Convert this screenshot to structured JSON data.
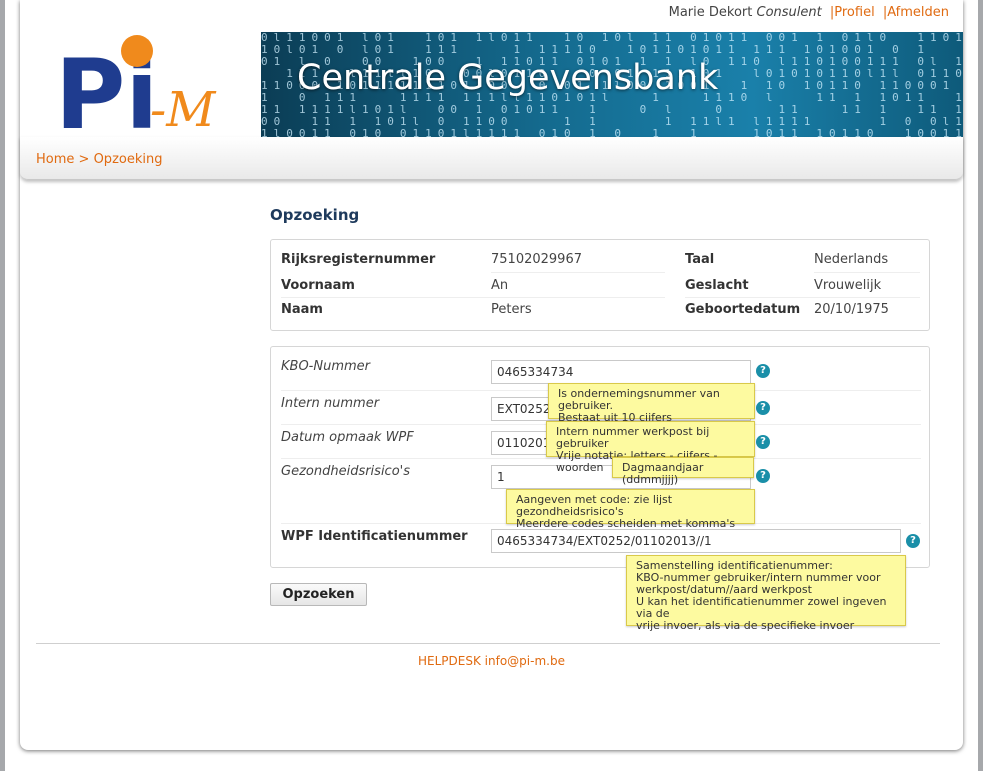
{
  "user": {
    "name": "Marie Dekort",
    "role": "Consulent",
    "profile_link": "Profiel",
    "logout_link": "Afmelden",
    "separator": "|"
  },
  "logo": {
    "text_main": "Pi",
    "text_accent": "-M"
  },
  "banner": {
    "title": "Centrale Gegevensbank"
  },
  "breadcrumb": {
    "home": "Home",
    "separator": ">",
    "current": "Opzoeking"
  },
  "page_title": "Opzoeking",
  "person": {
    "rijksregister_label": "Rijksregisternummer",
    "rijksregister_value": "75102029967",
    "taal_label": "Taal",
    "taal_value": "Nederlands",
    "voornaam_label": "Voornaam",
    "voornaam_value": "An",
    "geslacht_label": "Geslacht",
    "geslacht_value": "Vrouwelijk",
    "naam_label": "Naam",
    "naam_value": "Peters",
    "geboortedatum_label": "Geboortedatum",
    "geboortedatum_value": "20/10/1975"
  },
  "form": {
    "kbo": {
      "label": "KBO-Nummer",
      "value": "0465334734",
      "tooltip": "Is ondernemingsnummer van gebruiker.\nBestaat uit 10 cijfers"
    },
    "intern": {
      "label": "Intern nummer",
      "value": "EXT0252",
      "tooltip": "Intern nummer werkpost bij gebruiker\nVrije notatie: letters - cijfers - woorden"
    },
    "datum": {
      "label": "Datum opmaak WPF",
      "value": "01102013",
      "tooltip": "Dagmaandjaar (ddmmjjjj)"
    },
    "risico": {
      "label": "Gezondheidsrisico's",
      "value": "1",
      "tooltip": "Aangeven met code: zie lijst gezondheidsrisico's\nMeerdere codes scheiden met komma's"
    },
    "wpf": {
      "label": "WPF Identificatienummer",
      "value": "0465334734/EXT0252/01102013//1",
      "tooltip": "Samenstelling identificatienummer:\nKBO-nummer gebruiker/intern nummer voor\nwerkpost/datum//aard werkpost\nU kan het identificatienummer zowel ingeven via de\nvrije invoer, als via de specifieke invoer"
    },
    "help_glyph": "?"
  },
  "search_button": "Opzoeken",
  "footer": {
    "helpdesk": "HELPDESK info@pi-m.be"
  },
  "colors": {
    "accent": "#e06a10",
    "title": "#1e3a5c",
    "help": "#1a8fa8",
    "tooltip": "#fdfaa0"
  }
}
